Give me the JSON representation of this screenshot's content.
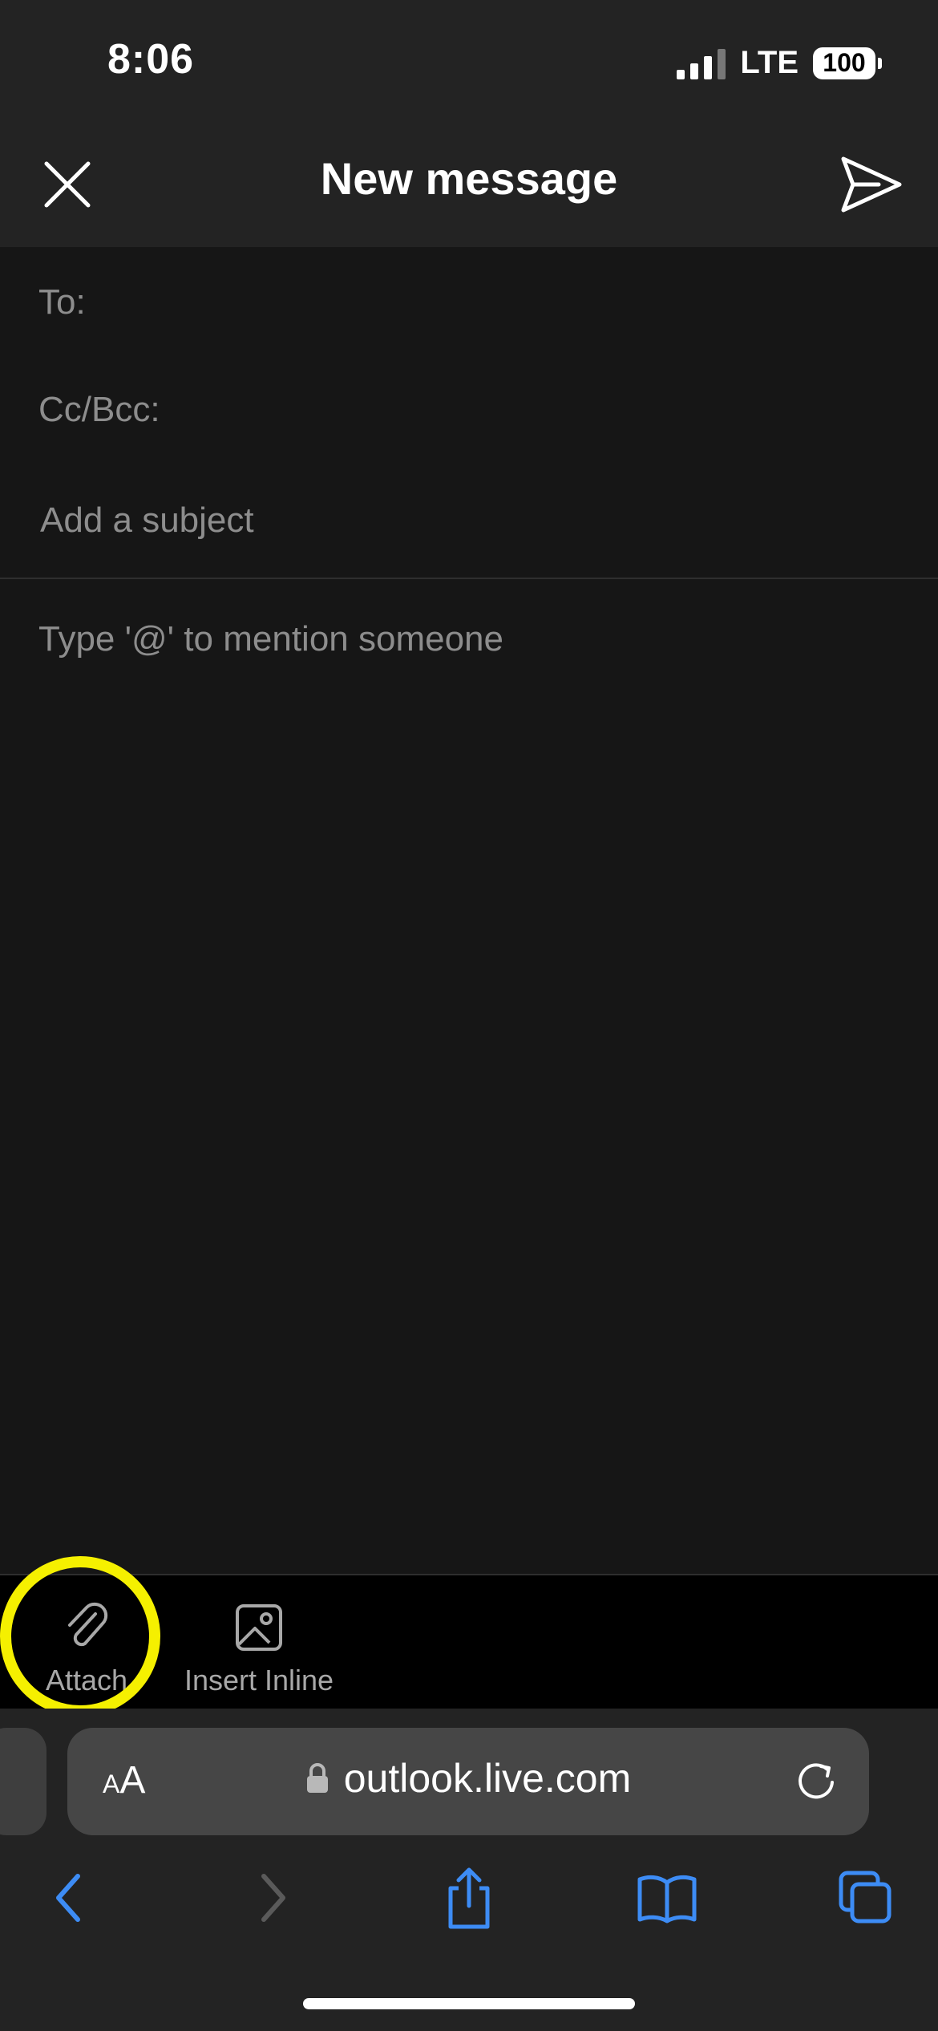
{
  "status_bar": {
    "time": "8:06",
    "network": "LTE",
    "battery": "100"
  },
  "header": {
    "title": "New message"
  },
  "compose": {
    "to_label": "To:",
    "cc_label": "Cc/Bcc:",
    "subject_placeholder": "Add a subject",
    "body_placeholder": "Type '@' to mention someone"
  },
  "toolbar": {
    "attach_label": "Attach",
    "insert_inline_label": "Insert Inline"
  },
  "browser": {
    "text_size_small": "A",
    "text_size_large": "A",
    "url": "outlook.live.com"
  },
  "colors": {
    "highlight": "#f5f000",
    "safari_blue": "#3d8cf5",
    "background": "#161616"
  },
  "icons": [
    "close-icon",
    "send-icon",
    "paperclip-icon",
    "image-icon",
    "lock-icon",
    "reload-icon",
    "back-icon",
    "forward-icon",
    "share-icon",
    "bookmarks-icon",
    "tabs-icon"
  ]
}
